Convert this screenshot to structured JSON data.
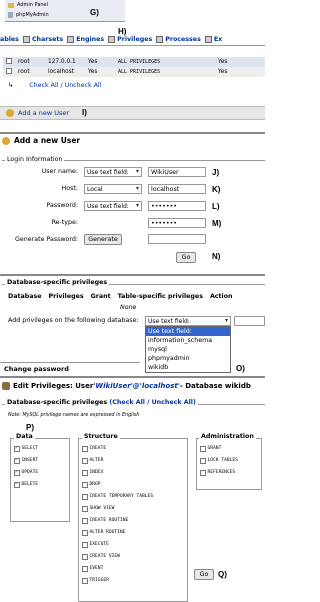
{
  "nav": {
    "items": [
      {
        "label": "Admin Panel"
      },
      {
        "label": "phpMyAdmin"
      }
    ],
    "step": "G)"
  },
  "tabs": {
    "items": [
      {
        "label": "ables"
      },
      {
        "label": "Charsets"
      },
      {
        "label": "Engines"
      },
      {
        "label": "Privileges"
      },
      {
        "label": "Processes"
      },
      {
        "label": "Ex"
      }
    ],
    "step": "H)"
  },
  "users_table": {
    "rows": [
      {
        "user": "root",
        "host": "127.0.0.1",
        "password": "Yes",
        "privileges": "ALL PRIVILEGES",
        "grant": "Yes"
      },
      {
        "user": "root",
        "host": "localhost",
        "password": "Yes",
        "privileges": "ALL PRIVILEGES",
        "grant": "Yes"
      }
    ],
    "check_all": "Check All / Uncheck All",
    "add_user": "Add a new User",
    "step": "I)"
  },
  "add_user_form": {
    "title": "Add a new User",
    "fieldset": "Login Information",
    "user_name_label": "User name:",
    "user_name_select": "Use text field:",
    "user_name_value": "WikiUser",
    "host_label": "Host:",
    "host_select": "Local",
    "host_value": "localhost",
    "password_label": "Password:",
    "password_select": "Use text field:",
    "password_value": "•••••••",
    "retype_label": "Re-type:",
    "retype_value": "•••••••",
    "generate_label": "Generate Password:",
    "generate_button": "Generate",
    "go_button": "Go",
    "steps": {
      "j": "J)",
      "k": "K)",
      "l": "L)",
      "m": "M)",
      "n": "N)"
    }
  },
  "db_privileges": {
    "legend": "Database-specific privileges",
    "columns": [
      "Database",
      "Privileges",
      "Grant",
      "Table-specific privileges",
      "Action"
    ],
    "none_text": "None",
    "add_label": "Add privileges on the following database:",
    "select_value": "Use text field:",
    "options": [
      "Use text field:",
      "information_schema",
      "mysql",
      "phpmyadmin",
      "wikidb"
    ],
    "change_password": "Change password",
    "step": "O)"
  },
  "edit_privileges": {
    "title_prefix": "Edit Privileges: User ",
    "title_user": "'WikiUser'@'localhost'",
    "title_suffix": " - Database wikidb",
    "legend": "Database-specific privileges",
    "check_all": "(Check All / Uncheck All)",
    "note": "Note: MySQL privilege names are expressed in English",
    "step_p": "P)",
    "data_legend": "Data",
    "data_items": [
      {
        "label": "SELECT",
        "checked": true
      },
      {
        "label": "INSERT",
        "checked": true
      },
      {
        "label": "UPDATE",
        "checked": true
      },
      {
        "label": "DELETE",
        "checked": true
      }
    ],
    "structure_legend": "Structure",
    "structure_items": [
      {
        "label": "CREATE"
      },
      {
        "label": "ALTER"
      },
      {
        "label": "INDEX"
      },
      {
        "label": "DROP"
      },
      {
        "label": "CREATE TEMPORARY TABLES"
      },
      {
        "label": "SHOW VIEW"
      },
      {
        "label": "CREATE ROUTINE"
      },
      {
        "label": "ALTER ROUTINE"
      },
      {
        "label": "EXECUTE"
      },
      {
        "label": "CREATE VIEW"
      },
      {
        "label": "EVENT"
      },
      {
        "label": "TRIGGER"
      }
    ],
    "admin_legend": "Administration",
    "admin_items": [
      {
        "label": "GRANT"
      },
      {
        "label": "LOCK TABLES"
      },
      {
        "label": "REFERENCES"
      }
    ],
    "go_button": "Go",
    "step_q": "Q)"
  }
}
